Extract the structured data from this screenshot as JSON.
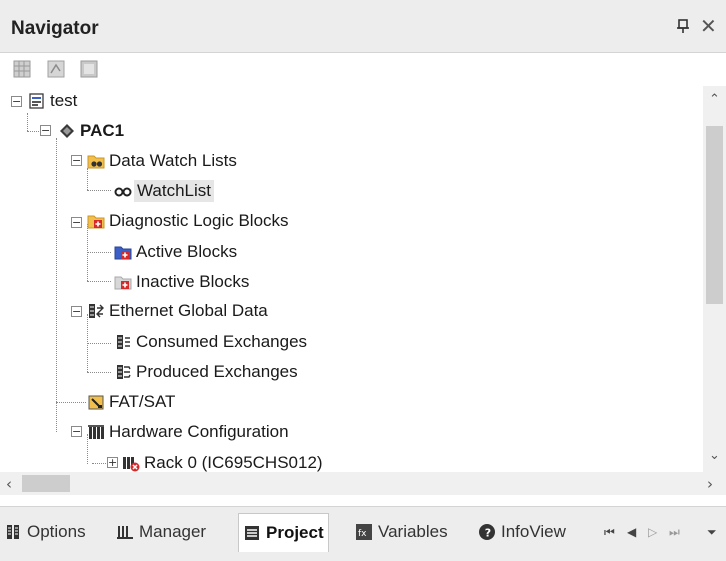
{
  "panel": {
    "title": "Navigator"
  },
  "toolbar": {
    "icons": [
      "grid-view-icon",
      "properties-icon",
      "list-view-icon"
    ]
  },
  "tree": {
    "items": [
      {
        "label": "test",
        "icon": "project-icon",
        "expanded": true,
        "level": 0
      },
      {
        "label": "PAC1",
        "icon": "target-diamond-icon",
        "expanded": true,
        "level": 1,
        "bold": true
      },
      {
        "label": "Data Watch Lists",
        "icon": "watch-folder-icon",
        "expanded": true,
        "level": 2
      },
      {
        "label": "WatchList",
        "icon": "glasses-icon",
        "level": 3,
        "selected": true
      },
      {
        "label": "Diagnostic Logic Blocks",
        "icon": "dlb-folder-icon",
        "expanded": true,
        "level": 2
      },
      {
        "label": "Active Blocks",
        "icon": "active-blocks-folder-icon",
        "level": 3
      },
      {
        "label": "Inactive Blocks",
        "icon": "inactive-blocks-folder-icon",
        "level": 3
      },
      {
        "label": "Ethernet Global Data",
        "icon": "egd-icon",
        "expanded": true,
        "level": 2
      },
      {
        "label": "Consumed Exchanges",
        "icon": "consumed-exchange-icon",
        "level": 3
      },
      {
        "label": "Produced Exchanges",
        "icon": "produced-exchange-icon",
        "level": 3
      },
      {
        "label": "FAT/SAT",
        "icon": "fat-sat-icon",
        "level": 2
      },
      {
        "label": "Hardware Configuration",
        "icon": "hardware-icon",
        "expanded": true,
        "level": 2
      },
      {
        "label": "Rack 0 (IC695CHS012)",
        "icon": "rack-error-icon",
        "expanded": false,
        "level": 3
      }
    ]
  },
  "tabs": [
    {
      "label": "Options",
      "icon": "options-icon"
    },
    {
      "label": "Manager",
      "icon": "manager-icon"
    },
    {
      "label": "Project",
      "icon": "project-tab-icon",
      "active": true
    },
    {
      "label": "Variables",
      "icon": "variables-icon"
    },
    {
      "label": "InfoView",
      "icon": "infoview-icon"
    }
  ],
  "colors": {
    "folder": "#f2c04a",
    "accent_red": "#d62a2a",
    "accent_blue": "#3b5fc7",
    "selection": "#e6e6e6"
  }
}
